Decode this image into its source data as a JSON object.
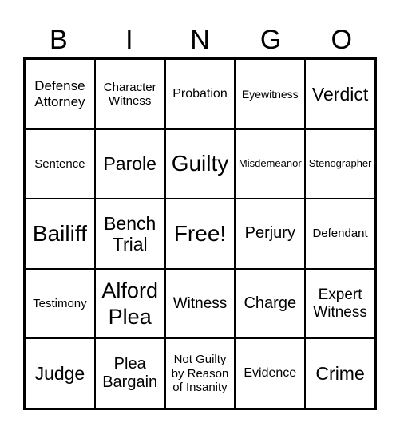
{
  "header": [
    "B",
    "I",
    "N",
    "G",
    "O"
  ],
  "cells": [
    [
      "Defense Attorney",
      "Character Witness",
      "Probation",
      "Eyewitness",
      "Verdict"
    ],
    [
      "Sentence",
      "Parole",
      "Guilty",
      "Misdemeanor",
      "Stenographer"
    ],
    [
      "Bailiff",
      "Bench Trial",
      "Free!",
      "Perjury",
      "Defendant"
    ],
    [
      "Testimony",
      "Alford Plea",
      "Witness",
      "Charge",
      "Expert Witness"
    ],
    [
      "Judge",
      "Plea Bargain",
      "Not Guilty by Reason of Insanity",
      "Evidence",
      "Crime"
    ]
  ]
}
